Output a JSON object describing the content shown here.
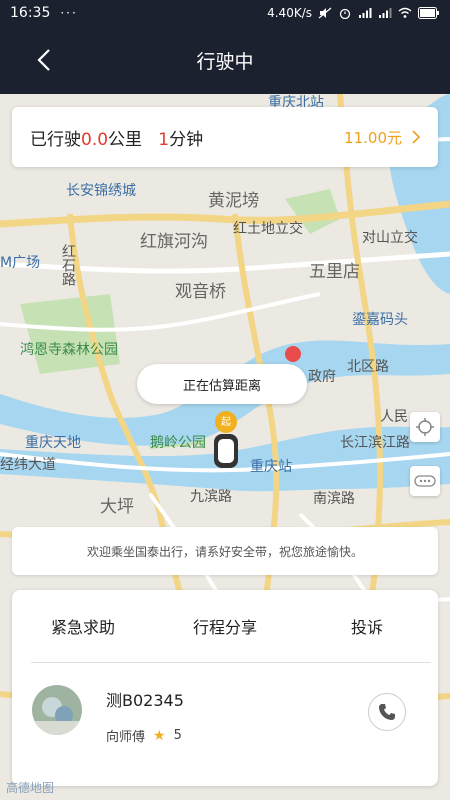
{
  "status_bar": {
    "time": "16:35",
    "speed": "4.40K/s",
    "battery": "▮"
  },
  "nav": {
    "title": "行驶中",
    "back_icon": "chevron-left-icon"
  },
  "trip": {
    "prefix": "已行驶",
    "distance": "0.0",
    "distance_unit": "公里",
    "minutes": "1",
    "minutes_unit": "分钟",
    "fare": "11.00元"
  },
  "map": {
    "labels": [
      {
        "text": "重庆北站",
        "cls": "blue"
      },
      {
        "text": "长安锦绣城",
        "cls": "blue"
      },
      {
        "text": "黄泥塝",
        "cls": "lg"
      },
      {
        "text": "红旗河沟",
        "cls": "lg"
      },
      {
        "text": "红土地立交",
        "cls": ""
      },
      {
        "text": "对山立交",
        "cls": ""
      },
      {
        "text": "五里店",
        "cls": "lg"
      },
      {
        "text": "观音桥",
        "cls": "lg"
      },
      {
        "text": "红石路",
        "cls": ""
      },
      {
        "text": "M广场",
        "cls": "blue"
      },
      {
        "text": "鸿恩寺森林公园",
        "cls": "green"
      },
      {
        "text": "鎏嘉码头",
        "cls": "blue"
      },
      {
        "text": "北区路",
        "cls": ""
      },
      {
        "text": "政府",
        "cls": ""
      },
      {
        "text": "人民",
        "cls": ""
      },
      {
        "text": "重庆天地",
        "cls": "blue"
      },
      {
        "text": "鹅岭公园",
        "cls": "green"
      },
      {
        "text": "重庆站",
        "cls": "blue"
      },
      {
        "text": "长江滨江路",
        "cls": ""
      },
      {
        "text": "经纬大道",
        "cls": ""
      },
      {
        "text": "大坪",
        "cls": "lg"
      },
      {
        "text": "九滨路",
        "cls": ""
      },
      {
        "text": "南滨路",
        "cls": ""
      }
    ],
    "start_marker": "起",
    "estimating": "正在估算距离",
    "controls": [
      "locate-icon",
      "more-icon"
    ]
  },
  "welcome": "欢迎乘坐国泰出行，请系好安全带，祝您旅途愉快。",
  "panel": {
    "actions": [
      "紧急求助",
      "行程分享",
      "投诉"
    ],
    "driver": {
      "plate": "测B02345",
      "name": "向师傅",
      "rating": "5"
    }
  },
  "logo": "高德地图",
  "colors": {
    "nav_bg": "#1c2130",
    "accent_red": "#e23b2e",
    "fare_orange": "#f0a020",
    "water": "#9fd0ee",
    "road": "#f6d98a",
    "park": "#c6e2b4"
  }
}
